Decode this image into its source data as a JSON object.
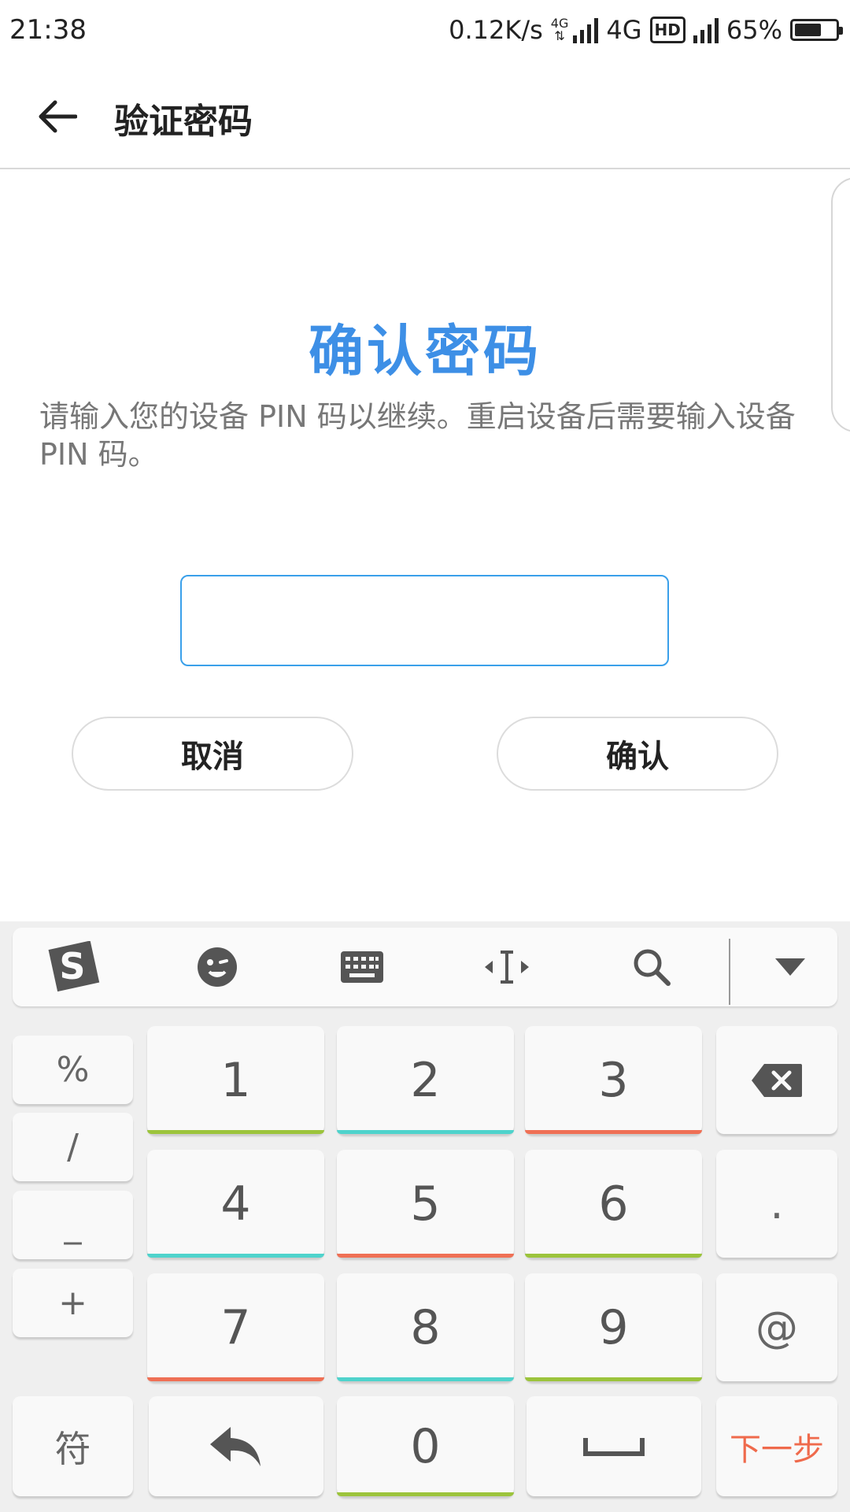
{
  "status_bar": {
    "time": "21:38",
    "net_speed": "0.12K/s",
    "net_type_small": "4G",
    "net_type": "4G",
    "hd_label": "HD",
    "battery_percent": "65%",
    "battery_level": 0.65
  },
  "header": {
    "title": "验证密码"
  },
  "main": {
    "heading": "确认密码",
    "description": "请输入您的设备 PIN 码以继续。重启设备后需要输入设备 PIN 码。",
    "pin_input_value": "",
    "cancel_label": "取消",
    "confirm_label": "确认"
  },
  "keyboard": {
    "toolbar_icons": [
      "sogou-logo-icon",
      "emoji-icon",
      "keyboard-icon",
      "cursor-move-icon",
      "search-icon",
      "hide-keyboard-icon"
    ],
    "side_keys": [
      "%",
      "/",
      "_",
      "+"
    ],
    "numbers": [
      "1",
      "2",
      "3",
      "4",
      "5",
      "6",
      "7",
      "8",
      "9",
      "0"
    ],
    "right_keys": [
      ".",
      "@"
    ],
    "symbol_label": "符",
    "next_label": "下一步",
    "stripe_colors": {
      "green": "#9cc43c",
      "teal": "#4fd3cc",
      "red": "#ef7055"
    },
    "accent_color": "#ef6a4c"
  },
  "colors": {
    "heading_blue": "#3d8fe6",
    "input_border": "#3aa0ea"
  }
}
